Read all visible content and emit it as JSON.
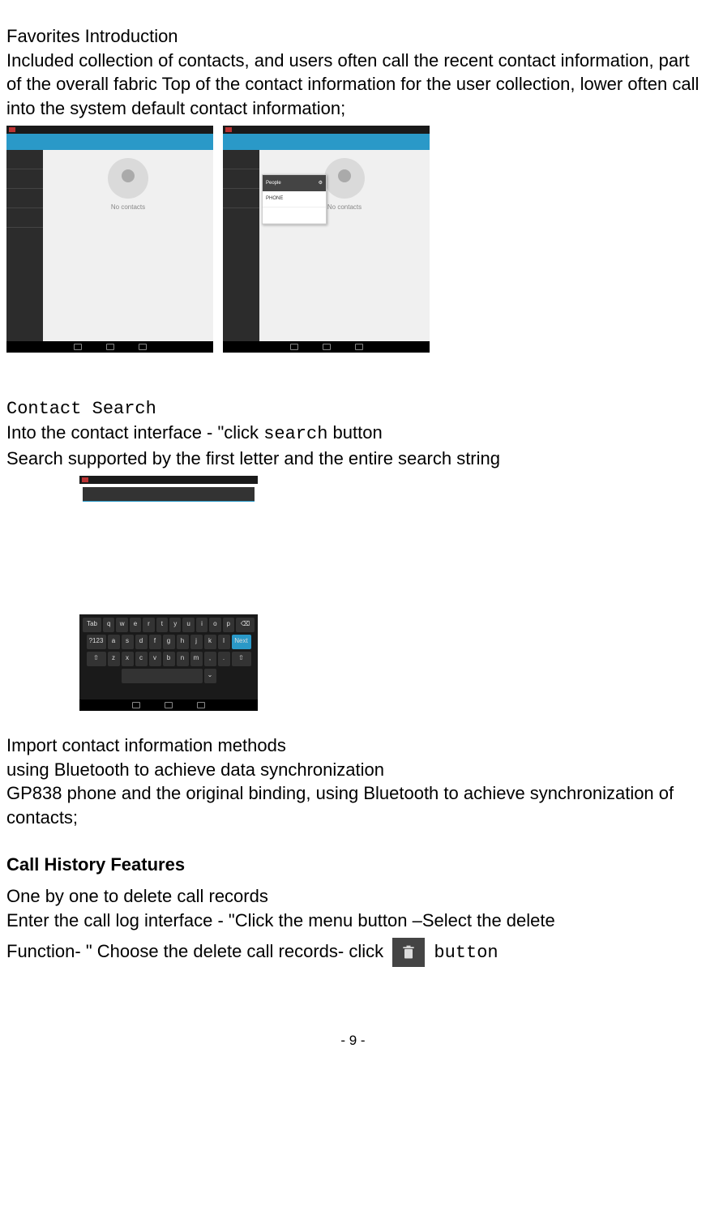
{
  "section1": {
    "title": "Favorites Introduction",
    "body": "Included collection of contacts, and users often call the recent contact information, part of the overall fabric Top of the contact information for the user collection, lower often call into the system default contact information;"
  },
  "screenshots_fav": {
    "no_contacts": "No contacts",
    "menu_title": "People",
    "menu_item1": "PHONE",
    "menu_item2": ""
  },
  "section2": {
    "title": "Contact Search",
    "line1_a": "Into the contact interface - \"click ",
    "line1_mono": "search",
    "line1_b": " button",
    "line2": "Search supported by the first letter and the entire search string"
  },
  "keyboard": {
    "row1": [
      "q",
      "w",
      "e",
      "r",
      "t",
      "y",
      "u",
      "i",
      "o",
      "p"
    ],
    "row2": [
      "a",
      "s",
      "d",
      "f",
      "g",
      "h",
      "j",
      "k",
      "l"
    ],
    "row3": [
      "z",
      "x",
      "c",
      "v",
      "b",
      "n",
      "m"
    ]
  },
  "section3": {
    "title": "Import contact information methods",
    "line1": "using Bluetooth to achieve data synchronization",
    "line2": "GP838 phone and the original binding, using Bluetooth to achieve synchronization of contacts;"
  },
  "section4": {
    "title": "Call History Features",
    "line1": "One by one to delete call records",
    "line2": "Enter the call log interface - \"Click the menu button –Select the delete",
    "line3_a": "Function- \" Choose the delete call records- click",
    "line3_b": "button"
  },
  "page_number": "- 9 -"
}
